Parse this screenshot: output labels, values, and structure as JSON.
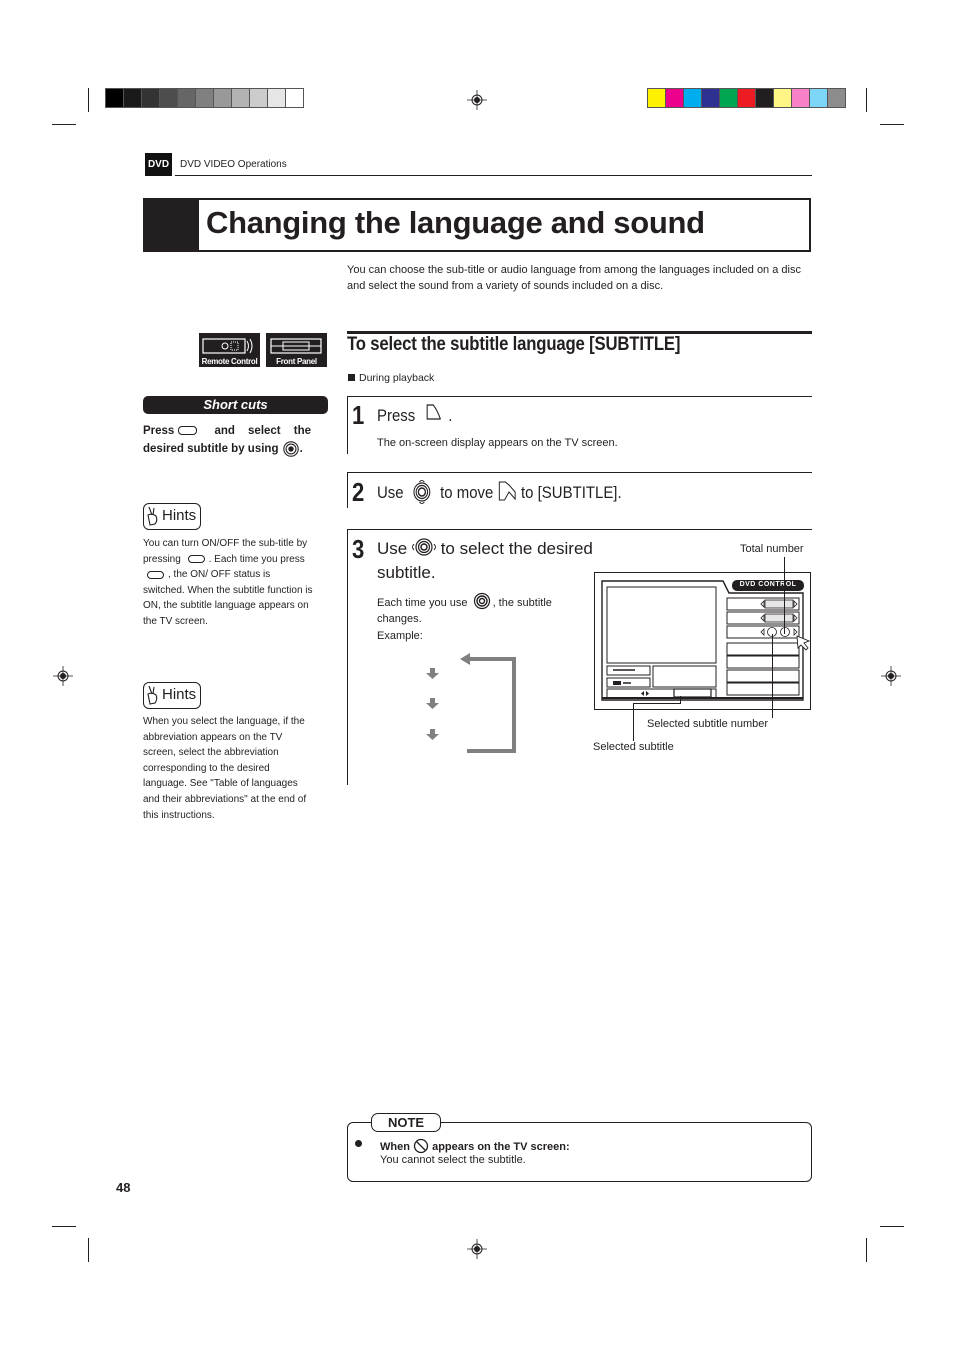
{
  "color_bars": {
    "grayscale": [
      "#000000",
      "#1a1a1a",
      "#333333",
      "#4d4d4d",
      "#666666",
      "#808080",
      "#999999",
      "#b3b3b3",
      "#cccccc",
      "#e6e6e6",
      "#ffffff"
    ],
    "process": [
      "#fff200",
      "#ec008c",
      "#00aeef",
      "#2e3192",
      "#00a651",
      "#ed1c24",
      "#231f20",
      "#fff685",
      "#f681c6",
      "#7dd6f7",
      "#8c8c8c"
    ]
  },
  "header": {
    "tag": "DVD",
    "section": "DVD VIDEO Operations"
  },
  "title": "Changing the language and sound",
  "intro": "You can choose the sub-title or audio language from among the languages included on a disc and select the sound from a variety of sounds included on a disc.",
  "sidebar": {
    "badges": [
      {
        "label": "Remote Control",
        "icon": "remote-control-icon"
      },
      {
        "label": "Front Panel",
        "icon": "front-panel-icon"
      }
    ],
    "shortcuts": {
      "title": "Short cuts",
      "text_before": "Press",
      "text_after": "and select the desired subtitle by using",
      "end": "."
    },
    "hints": [
      {
        "label": "Hints",
        "parts": [
          "You can turn ON/OFF the sub-title by pressing",
          ". Each time you press",
          ", the ON/ OFF status is switched. When the subtitle function is ON, the subtitle language appears on the TV screen."
        ]
      },
      {
        "label": "Hints",
        "text": "When you select the language, if the abbreviation appears on the TV screen, select the abbreviation corresponding to the desired language. See \"Table of languages and their abbreviations\" at the end of this instructions."
      }
    ]
  },
  "section": {
    "title": "To select the subtitle language [SUBTITLE]",
    "condition": "During playback",
    "steps": [
      {
        "num": "1",
        "text_before": "Press",
        "text_after": ".",
        "sub": "The on-screen display appears on the TV screen."
      },
      {
        "num": "2",
        "text_use": "Use",
        "text_mid": "to move",
        "text_after": "to [SUBTITLE]."
      },
      {
        "num": "3",
        "text_use": "Use",
        "text_after": "to select the desired subtitle.",
        "sub_before": "Each time you use",
        "sub_after": ", the subtitle changes.",
        "example_label": "Example:"
      }
    ]
  },
  "diagram": {
    "header": "DVD CONTROL",
    "callouts": {
      "total": "Total number",
      "selected_number": "Selected subtitle number",
      "selected": "Selected subtitle"
    }
  },
  "note": {
    "label": "NOTE",
    "head_before": "When",
    "head_after": "appears on the TV screen:",
    "body": "You cannot select the subtitle."
  },
  "page_number": "48"
}
